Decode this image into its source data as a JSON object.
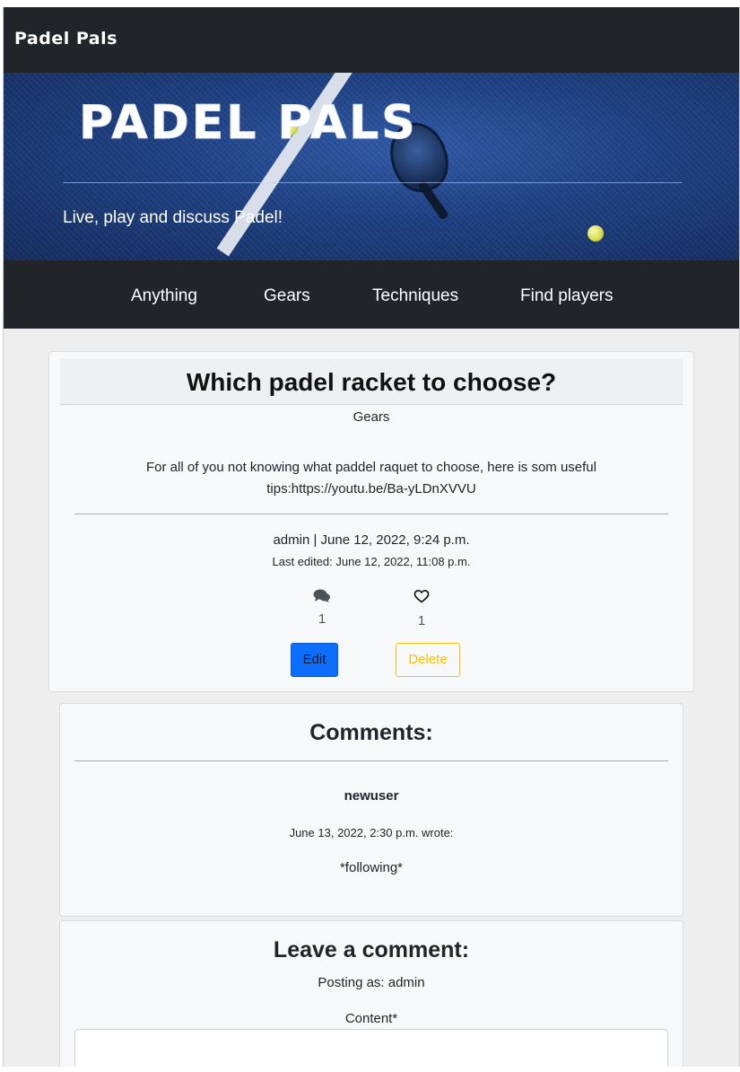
{
  "topbar": {
    "brand": "Padel Pals"
  },
  "hero": {
    "title": "PADEL PALS",
    "subtitle": "Live, play and discuss Padel!"
  },
  "nav": {
    "items": [
      {
        "label": "Anything"
      },
      {
        "label": "Gears"
      },
      {
        "label": "Techniques"
      },
      {
        "label": "Find players"
      }
    ]
  },
  "post": {
    "title": "Which padel racket to choose?",
    "category": "Gears",
    "body_line1": "For all of you not knowing what paddel raquet to choose, here is som useful",
    "body_line2": "tips:https://youtu.be/Ba-yLDnXVVU",
    "meta": "admin | June 12, 2022, 9:24 p.m.",
    "last_edited": "Last edited: June 12, 2022, 11:08 p.m.",
    "comment_count": "1",
    "like_count": "1",
    "edit_label": "Edit",
    "delete_label": "Delete",
    "icons": {
      "comments": "comments-icon",
      "likes": "heart-outline-icon"
    }
  },
  "comments": {
    "heading": "Comments:",
    "items": [
      {
        "author": "newuser",
        "date_line": "June 13, 2022, 2:30 p.m. wrote:",
        "text": "*following*"
      }
    ]
  },
  "leave_comment": {
    "heading": "Leave a comment:",
    "posting_as": "Posting as: admin",
    "content_label": "Content*",
    "content_value": ""
  },
  "colors": {
    "navbar": "#212529",
    "primary": "#0d6efd",
    "warning": "#ffc107",
    "page_bg": "#eeeeee"
  }
}
